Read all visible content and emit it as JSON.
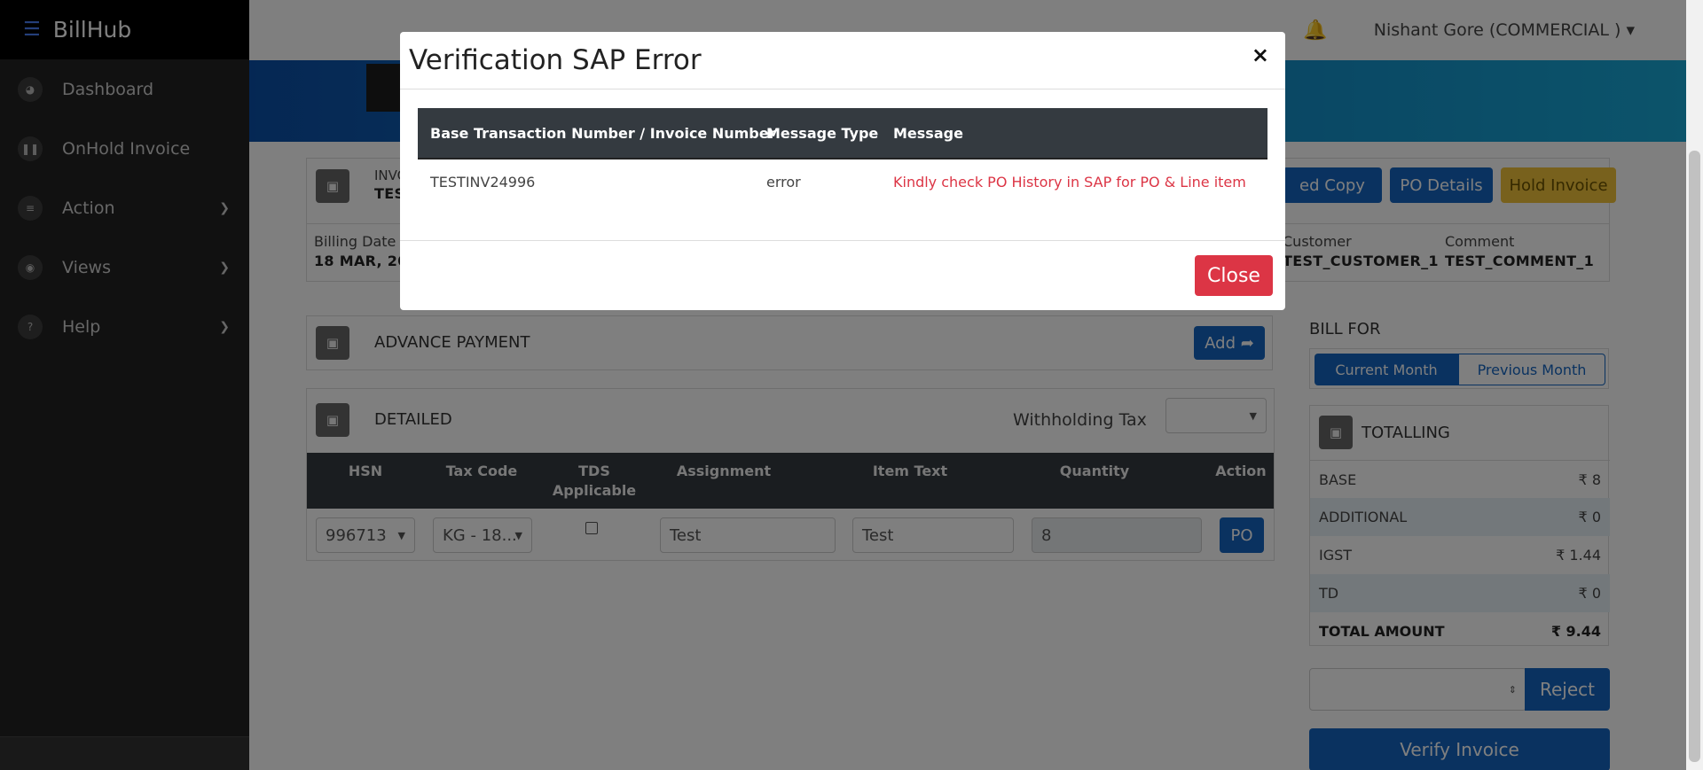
{
  "app": {
    "name": "BillHub",
    "menu_icon": "hamburger-icon"
  },
  "sidebar": {
    "items": [
      {
        "label": "Dashboard",
        "icon": "dashboard-icon",
        "has_submenu": false
      },
      {
        "label": "OnHold Invoice",
        "icon": "pause-icon",
        "has_submenu": false
      },
      {
        "label": "Action",
        "icon": "list-icon",
        "has_submenu": true
      },
      {
        "label": "Views",
        "icon": "eye-icon",
        "has_submenu": true
      },
      {
        "label": "Help",
        "icon": "help-icon",
        "has_submenu": true
      }
    ]
  },
  "topbar": {
    "user": "Nishant Gore (COMMERCIAL )",
    "bell_icon": "bell-icon"
  },
  "invoice": {
    "label_partial": "INVO",
    "value_partial": "TES",
    "buttons": {
      "signed_copy": "ed Copy",
      "po_details": "PO Details",
      "hold": "Hold Invoice"
    },
    "billing_date_label": "Billing Date",
    "billing_date_value": "18 MAR, 202",
    "customer_label": "Customer",
    "customer_value": "TEST_CUSTOMER_1",
    "comment_label": "Comment",
    "comment_value": "TEST_COMMENT_1"
  },
  "advance_payment": {
    "title": "ADVANCE PAYMENT",
    "add_label": "Add"
  },
  "detailed": {
    "title": "DETAILED",
    "withholding_label": "Withholding Tax",
    "columns": [
      "HSN",
      "Tax Code",
      "TDS Applicable",
      "Assignment",
      "Item Text",
      "Quantity",
      "Action"
    ],
    "row": {
      "hsn": "996713",
      "tax_code": "KG - 18...",
      "tds_checked": false,
      "assignment": "Test",
      "item_text": "Test",
      "quantity": "8",
      "action": "PO"
    }
  },
  "bill_for": {
    "title": "BILL FOR",
    "current": "Current Month",
    "previous": "Previous Month",
    "selected": "Current Month"
  },
  "totalling": {
    "title": "TOTALLING",
    "rows": [
      {
        "label": "BASE",
        "value": "₹ 8"
      },
      {
        "label": "ADDITIONAL",
        "value": "₹ 0"
      },
      {
        "label": "IGST",
        "value": "₹ 1.44"
      },
      {
        "label": "TD",
        "value": "₹ 0"
      }
    ],
    "total_label": "TOTAL AMOUNT",
    "total_value": "₹ 9.44"
  },
  "actions": {
    "reject": "Reject",
    "verify": "Verify Invoice"
  },
  "modal": {
    "title": "Verification SAP Error",
    "close_x": "×",
    "columns": [
      "Base Transaction Number / Invoice Number",
      "Message Type",
      "Message"
    ],
    "rows": [
      {
        "number": "TESTINV24996",
        "type": "error",
        "message": "Kindly check PO History in SAP for PO & Line item"
      }
    ],
    "close_label": "Close"
  },
  "colors": {
    "primary": "#1565c0",
    "danger": "#dc3545",
    "warning": "#f0c23a",
    "sidebar": "#232323"
  }
}
